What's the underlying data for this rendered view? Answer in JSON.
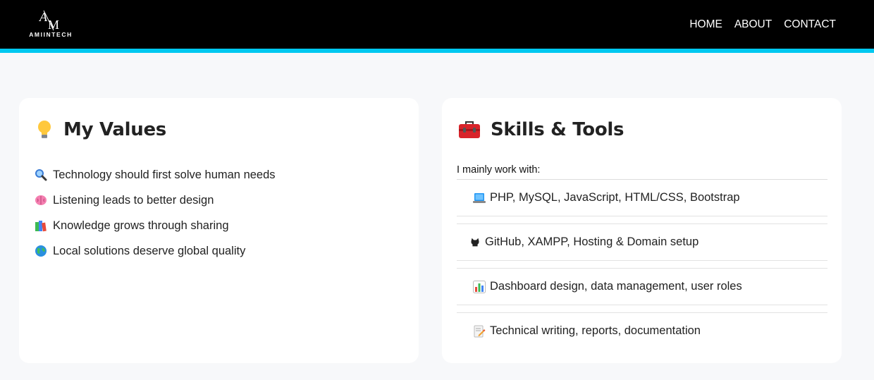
{
  "header": {
    "logo_text": "AMIINTECH",
    "logo_mark": "AM",
    "nav": [
      {
        "label": "HOME"
      },
      {
        "label": "ABOUT"
      },
      {
        "label": "CONTACT"
      }
    ]
  },
  "values_card": {
    "icon": "lightbulb-icon",
    "title": "My Values",
    "items": [
      {
        "icon": "magnifier-icon",
        "text": "Technology should first solve human needs"
      },
      {
        "icon": "brain-icon",
        "text": "Listening leads to better design"
      },
      {
        "icon": "books-icon",
        "text": "Knowledge grows through sharing"
      },
      {
        "icon": "globe-icon",
        "text": "Local solutions deserve global quality"
      }
    ]
  },
  "skills_card": {
    "icon": "toolbox-icon",
    "title": "Skills & Tools",
    "intro": "I mainly work with:",
    "items": [
      {
        "icon": "laptop-icon",
        "text": "PHP, MySQL, JavaScript, HTML/CSS, Bootstrap"
      },
      {
        "icon": "octocat-icon",
        "text": "GitHub, XAMPP, Hosting & Domain setup"
      },
      {
        "icon": "bar-chart-icon",
        "text": "Dashboard design, data management, user roles"
      },
      {
        "icon": "memo-icon",
        "text": "Technical writing, reports, documentation"
      }
    ]
  },
  "colors": {
    "topbar": "#000000",
    "accent": "#00c8f0",
    "page_bg": "#f7f8fa",
    "card_bg": "#ffffff"
  }
}
